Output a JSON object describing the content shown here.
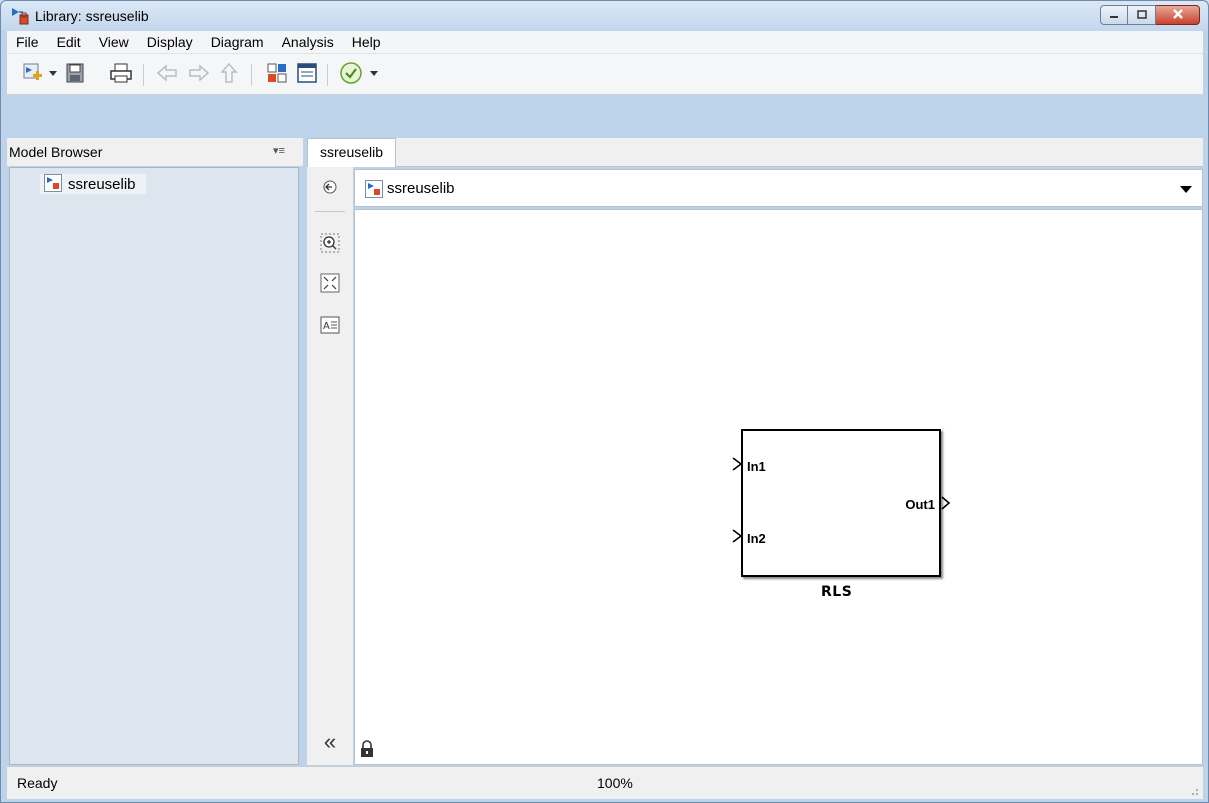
{
  "window": {
    "title": "Library: ssreuselib",
    "controls": [
      "minimize-icon",
      "maximize-icon",
      "close-icon"
    ]
  },
  "menubar": {
    "items": [
      "File",
      "Edit",
      "View",
      "Display",
      "Diagram",
      "Analysis",
      "Help"
    ]
  },
  "toolbar": {
    "icons": [
      "new-model-icon",
      "save-icon",
      "print-icon",
      "back-arrow-icon",
      "forward-arrow-icon",
      "up-arrow-icon",
      "library-browser-icon",
      "model-explorer-icon",
      "check-icon"
    ]
  },
  "model_browser": {
    "title": "Model Browser",
    "tree": [
      {
        "label": "ssreuselib",
        "icon": "library-model-icon"
      }
    ]
  },
  "tabs": [
    {
      "label": "ssreuselib",
      "active": true
    }
  ],
  "address": {
    "path": "ssreuselib"
  },
  "canvas": {
    "block": {
      "name": "RLS",
      "inputs": [
        "In1",
        "In2"
      ],
      "outputs": [
        "Out1"
      ]
    }
  },
  "status": {
    "text": "Ready",
    "zoom": "100%"
  },
  "colors": {
    "window_frame": "#bcd3ea",
    "close_button": "#c6432d",
    "browser_panel": "#dde6ef",
    "canvas_bg": "#ffffff"
  }
}
